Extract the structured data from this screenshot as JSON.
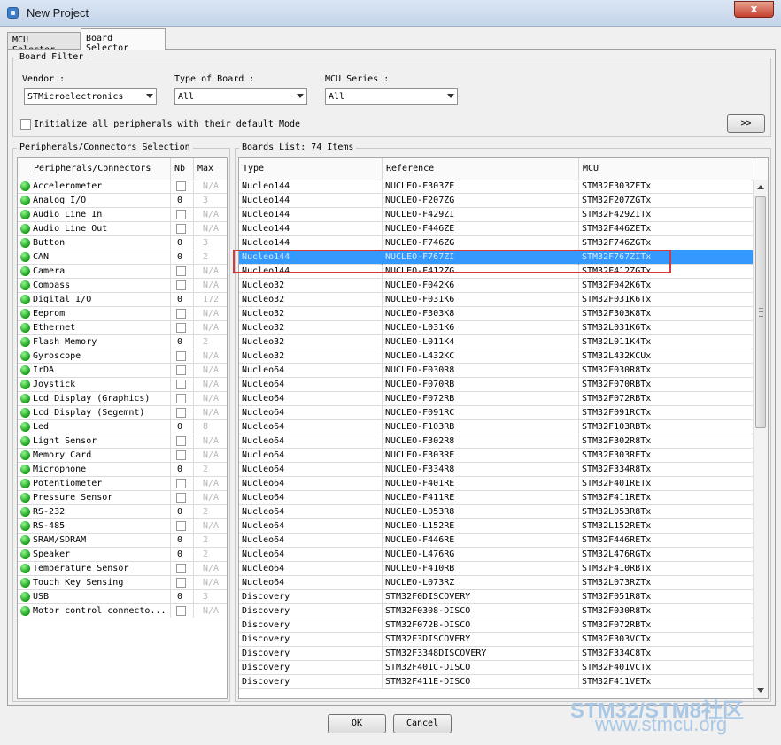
{
  "window": {
    "title": "New Project",
    "close_label": "x"
  },
  "tabs": [
    {
      "label": "MCU Selector"
    },
    {
      "label": "Board Selector"
    }
  ],
  "board_filter": {
    "title": "Board Filter",
    "vendor_label": "Vendor :",
    "vendor_value": "STMicroelectronics",
    "type_label": "Type of Board :",
    "type_value": "All",
    "series_label": "MCU Series :",
    "series_value": "All",
    "init_label": "Initialize all peripherals with their default Mode",
    "expand_label": ">>"
  },
  "peripherals": {
    "title": "Peripherals/Connectors Selection",
    "headers": [
      "Peripherals/Connectors",
      "Nb",
      "Max"
    ],
    "rows": [
      {
        "name": "Accelerometer",
        "nb": "",
        "max": "N/A"
      },
      {
        "name": "Analog I/O",
        "nb": "0",
        "max": "3"
      },
      {
        "name": "Audio Line In",
        "nb": "",
        "max": "N/A"
      },
      {
        "name": "Audio Line Out",
        "nb": "",
        "max": "N/A"
      },
      {
        "name": "Button",
        "nb": "0",
        "max": "3"
      },
      {
        "name": "CAN",
        "nb": "0",
        "max": "2"
      },
      {
        "name": "Camera",
        "nb": "",
        "max": "N/A"
      },
      {
        "name": "Compass",
        "nb": "",
        "max": "N/A"
      },
      {
        "name": "Digital I/O",
        "nb": "0",
        "max": "172"
      },
      {
        "name": "Eeprom",
        "nb": "",
        "max": "N/A"
      },
      {
        "name": "Ethernet",
        "nb": "",
        "max": "N/A"
      },
      {
        "name": "Flash Memory",
        "nb": "0",
        "max": "2"
      },
      {
        "name": "Gyroscope",
        "nb": "",
        "max": "N/A"
      },
      {
        "name": "IrDA",
        "nb": "",
        "max": "N/A"
      },
      {
        "name": "Joystick",
        "nb": "",
        "max": "N/A"
      },
      {
        "name": "Lcd Display (Graphics)",
        "nb": "",
        "max": "N/A"
      },
      {
        "name": "Lcd Display (Segemnt)",
        "nb": "",
        "max": "N/A"
      },
      {
        "name": "Led",
        "nb": "0",
        "max": "8"
      },
      {
        "name": "Light Sensor",
        "nb": "",
        "max": "N/A"
      },
      {
        "name": "Memory Card",
        "nb": "",
        "max": "N/A"
      },
      {
        "name": "Microphone",
        "nb": "0",
        "max": "2"
      },
      {
        "name": "Potentiometer",
        "nb": "",
        "max": "N/A"
      },
      {
        "name": "Pressure Sensor",
        "nb": "",
        "max": "N/A"
      },
      {
        "name": "RS-232",
        "nb": "0",
        "max": "2"
      },
      {
        "name": "RS-485",
        "nb": "",
        "max": "N/A"
      },
      {
        "name": "SRAM/SDRAM",
        "nb": "0",
        "max": "2"
      },
      {
        "name": "Speaker",
        "nb": "0",
        "max": "2"
      },
      {
        "name": "Temperature Sensor",
        "nb": "",
        "max": "N/A"
      },
      {
        "name": "Touch Key Sensing",
        "nb": "",
        "max": "N/A"
      },
      {
        "name": "USB",
        "nb": "0",
        "max": "3"
      },
      {
        "name": "Motor control connecto...",
        "nb": "",
        "max": "N/A"
      }
    ]
  },
  "boards": {
    "title": "Boards List: 74 Items",
    "headers": [
      "Type",
      "Reference",
      "MCU"
    ],
    "selected_index": 5,
    "rows": [
      [
        "Nucleo144",
        "NUCLEO-F303ZE",
        "STM32F303ZETx"
      ],
      [
        "Nucleo144",
        "NUCLEO-F207ZG",
        "STM32F207ZGTx"
      ],
      [
        "Nucleo144",
        "NUCLEO-F429ZI",
        "STM32F429ZITx"
      ],
      [
        "Nucleo144",
        "NUCLEO-F446ZE",
        "STM32F446ZETx"
      ],
      [
        "Nucleo144",
        "NUCLEO-F746ZG",
        "STM32F746ZGTx"
      ],
      [
        "Nucleo144",
        "NUCLEO-F767ZI",
        "STM32F767ZITx"
      ],
      [
        "Nucleo144",
        "NUCLEO-F412ZG",
        "STM32F412ZGTx"
      ],
      [
        "Nucleo32",
        "NUCLEO-F042K6",
        "STM32F042K6Tx"
      ],
      [
        "Nucleo32",
        "NUCLEO-F031K6",
        "STM32F031K6Tx"
      ],
      [
        "Nucleo32",
        "NUCLEO-F303K8",
        "STM32F303K8Tx"
      ],
      [
        "Nucleo32",
        "NUCLEO-L031K6",
        "STM32L031K6Tx"
      ],
      [
        "Nucleo32",
        "NUCLEO-L011K4",
        "STM32L011K4Tx"
      ],
      [
        "Nucleo32",
        "NUCLEO-L432KC",
        "STM32L432KCUx"
      ],
      [
        "Nucleo64",
        "NUCLEO-F030R8",
        "STM32F030R8Tx"
      ],
      [
        "Nucleo64",
        "NUCLEO-F070RB",
        "STM32F070RBTx"
      ],
      [
        "Nucleo64",
        "NUCLEO-F072RB",
        "STM32F072RBTx"
      ],
      [
        "Nucleo64",
        "NUCLEO-F091RC",
        "STM32F091RCTx"
      ],
      [
        "Nucleo64",
        "NUCLEO-F103RB",
        "STM32F103RBTx"
      ],
      [
        "Nucleo64",
        "NUCLEO-F302R8",
        "STM32F302R8Tx"
      ],
      [
        "Nucleo64",
        "NUCLEO-F303RE",
        "STM32F303RETx"
      ],
      [
        "Nucleo64",
        "NUCLEO-F334R8",
        "STM32F334R8Tx"
      ],
      [
        "Nucleo64",
        "NUCLEO-F401RE",
        "STM32F401RETx"
      ],
      [
        "Nucleo64",
        "NUCLEO-F411RE",
        "STM32F411RETx"
      ],
      [
        "Nucleo64",
        "NUCLEO-L053R8",
        "STM32L053R8Tx"
      ],
      [
        "Nucleo64",
        "NUCLEO-L152RE",
        "STM32L152RETx"
      ],
      [
        "Nucleo64",
        "NUCLEO-F446RE",
        "STM32F446RETx"
      ],
      [
        "Nucleo64",
        "NUCLEO-L476RG",
        "STM32L476RGTx"
      ],
      [
        "Nucleo64",
        "NUCLEO-F410RB",
        "STM32F410RBTx"
      ],
      [
        "Nucleo64",
        "NUCLEO-L073RZ",
        "STM32L073RZTx"
      ],
      [
        "Discovery",
        "STM32F0DISCOVERY",
        "STM32F051R8Tx"
      ],
      [
        "Discovery",
        "STM32F0308-DISCO",
        "STM32F030R8Tx"
      ],
      [
        "Discovery",
        "STM32F072B-DISCO",
        "STM32F072RBTx"
      ],
      [
        "Discovery",
        "STM32F3DISCOVERY",
        "STM32F303VCTx"
      ],
      [
        "Discovery",
        "STM32F3348DISCOVERY",
        "STM32F334C8Tx"
      ],
      [
        "Discovery",
        "STM32F401C-DISCO",
        "STM32F401VCTx"
      ],
      [
        "Discovery",
        "STM32F411E-DISCO",
        "STM32F411VETx"
      ]
    ]
  },
  "footer": {
    "ok_label": "OK",
    "cancel_label": "Cancel"
  },
  "watermark": {
    "line1": "STM32/STM8社区",
    "line2": "www.stmcu.org"
  }
}
